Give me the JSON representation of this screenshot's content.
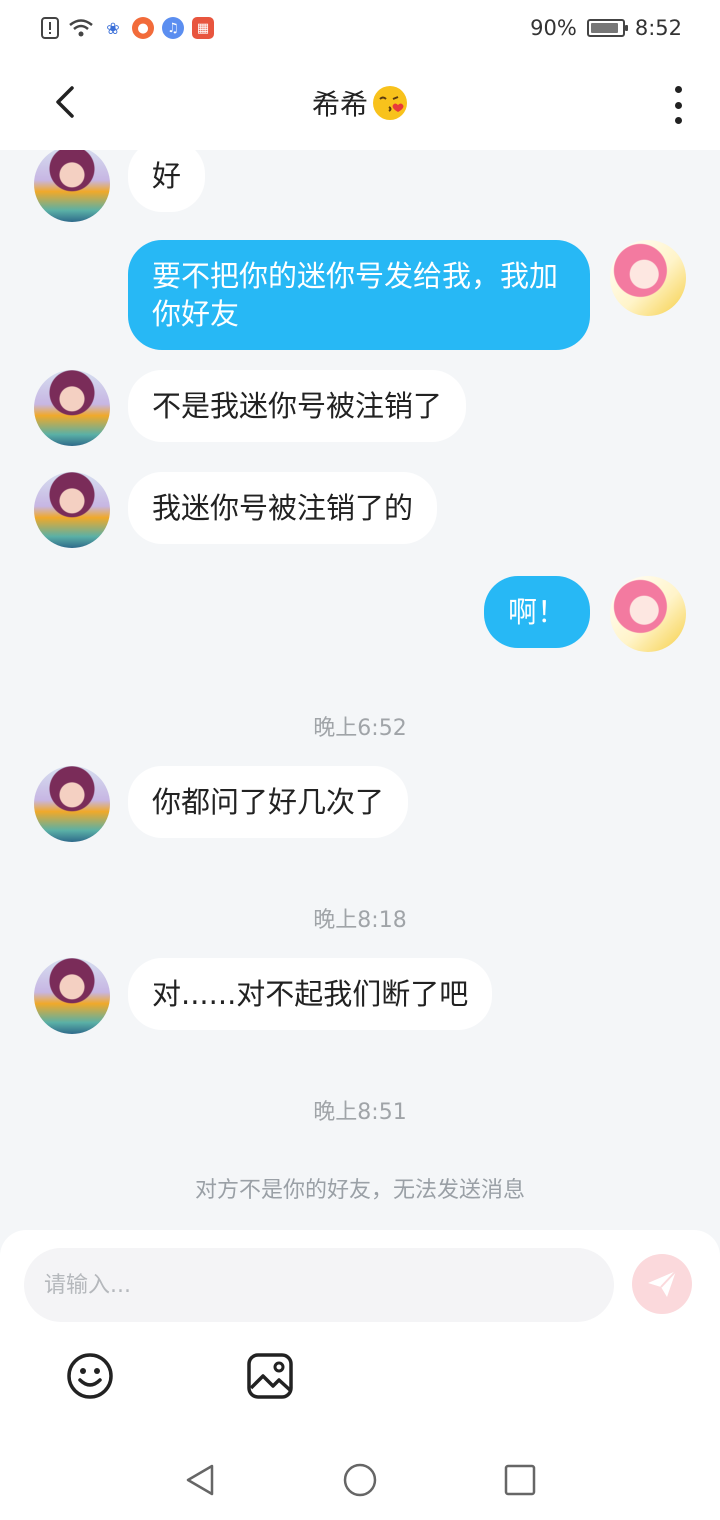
{
  "status_bar": {
    "battery": "90%",
    "time": "8:52",
    "icons": [
      "alert-icon",
      "wifi-icon",
      "baidu-icon",
      "app-icon",
      "music-icon",
      "huawei-icon"
    ]
  },
  "header": {
    "title": "希希",
    "emoji": "kissing-face-emoji"
  },
  "messages": [
    {
      "side": "them",
      "text": "好"
    },
    {
      "side": "me",
      "text": "要不把你的迷你号发给我，我加你好友"
    },
    {
      "side": "them",
      "text": "不是我迷你号被注销了"
    },
    {
      "side": "them",
      "text": "我迷你号被注销了的"
    },
    {
      "side": "me",
      "text": "啊！"
    },
    {
      "side": "time",
      "text": "晚上6:52"
    },
    {
      "side": "them",
      "text": "你都问了好几次了"
    },
    {
      "side": "time",
      "text": "晚上8:18"
    },
    {
      "side": "them",
      "text": "对......对不起我们断了吧"
    },
    {
      "side": "time",
      "text": "晚上8:51"
    }
  ],
  "notice": "对方不是你的好友，无法发送消息",
  "input": {
    "placeholder": "请输入..."
  },
  "colors": {
    "my_bubble": "#27b8f5",
    "their_bubble": "#ffffff",
    "background": "#f4f6f8",
    "send_button": "#fbd9dc"
  }
}
